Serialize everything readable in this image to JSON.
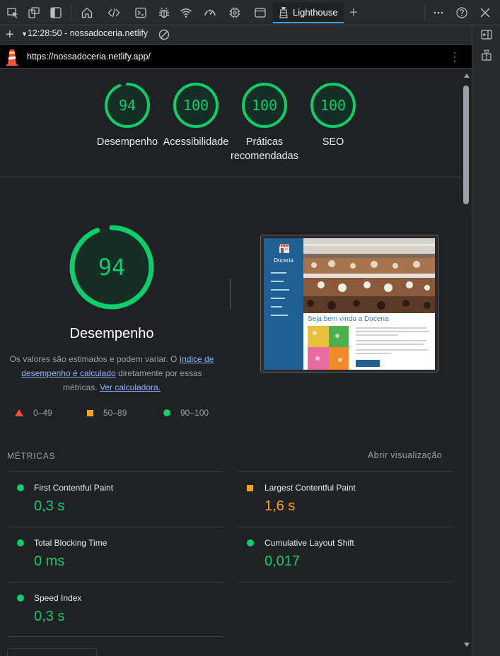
{
  "devtools": {
    "tabs": [
      {
        "icon": "inspect-icon"
      },
      {
        "icon": "device-toolbar-icon"
      },
      {
        "icon": "dock-sidebar-icon"
      },
      {
        "icon": "home-icon"
      },
      {
        "icon": "elements-icon"
      },
      {
        "icon": "console-icon"
      },
      {
        "icon": "sources-bug-icon"
      },
      {
        "icon": "network-wifi-icon"
      },
      {
        "icon": "performance-gauge-icon"
      },
      {
        "icon": "memory-chip-icon"
      },
      {
        "icon": "application-window-icon"
      }
    ],
    "active_tab": "Lighthouse",
    "accent": "#3aa3ff"
  },
  "report_bar": {
    "selected_report": "12:28:50 - nossadoceria.netlify"
  },
  "url_bar": {
    "url": "https://nossadoceria.netlify.app/"
  },
  "scores": [
    {
      "label": "Desempenho",
      "value": "94"
    },
    {
      "label": "Acessibilidade",
      "value": "100"
    },
    {
      "label": "Práticas recomendadas",
      "label_line1": "Práticas",
      "label_line2": "recomendadas",
      "value": "100"
    },
    {
      "label": "SEO",
      "value": "100"
    }
  ],
  "performance": {
    "score": "94",
    "score_fraction": 0.94,
    "title": "Desempenho",
    "desc_part1": "Os valores são estimados e podem variar. O ",
    "desc_link1": "índice de desempenho é calculado",
    "desc_part2": " diretamente por essas métricas. ",
    "desc_link2": "Ver calculadora.",
    "legend": [
      {
        "shape": "triangle",
        "range": "0–49",
        "color": "#ff4e42"
      },
      {
        "shape": "square",
        "range": "50–89",
        "color": "#ffa400"
      },
      {
        "shape": "circle",
        "range": "90–100",
        "color": "#0cce6b"
      }
    ]
  },
  "screenshot": {
    "brand": "Doceria",
    "welcome": "Seja bem vindo a Doceria"
  },
  "metrics": {
    "header": "MÉTRICAS",
    "toggle": "Abrir visualização",
    "items": [
      {
        "title": "First Contentful Paint",
        "value": "0,3 s",
        "rating": "pass"
      },
      {
        "title": "Largest Contentful Paint",
        "value": "1,6 s",
        "rating": "average"
      },
      {
        "title": "Total Blocking Time",
        "value": "0 ms",
        "rating": "pass"
      },
      {
        "title": "Cumulative Layout Shift",
        "value": "0,017",
        "rating": "pass"
      },
      {
        "title": "Speed Index",
        "value": "0,3 s",
        "rating": "pass"
      }
    ]
  },
  "colors": {
    "pass": "#0cce6b",
    "average": "#ffa400",
    "fail": "#ff4e42",
    "link": "#8ab4f8"
  }
}
